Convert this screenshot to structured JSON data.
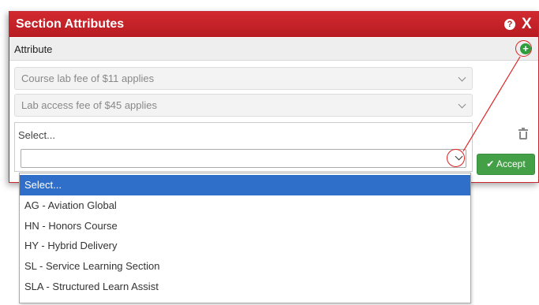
{
  "dialog": {
    "title": "Section Attributes",
    "help_icon": "?",
    "close_icon": "X",
    "header_label": "Attribute",
    "add_icon": "+"
  },
  "attributes": [
    {
      "label": "Course lab fee of $11 applies"
    },
    {
      "label": "Lab access fee of $45 applies"
    }
  ],
  "new_attribute": {
    "placeholder": "Select..."
  },
  "accept_label": "✔ Accept",
  "dropdown": {
    "options": [
      "Select...",
      "AG - Aviation Global",
      "HN - Honors Course",
      "HY - Hybrid Delivery",
      "SL - Service Learning Section",
      "SLA - Structured Learn Assist"
    ],
    "selected_index": 0
  },
  "colors": {
    "title_bar": "#c62127",
    "accept": "#43a047",
    "selected_option": "#2f6fc9",
    "callout": "#dd2222"
  },
  "icons": [
    "help-icon",
    "close-icon",
    "add-circle-icon",
    "trash-icon",
    "chevron-down-icon",
    "check-icon"
  ]
}
